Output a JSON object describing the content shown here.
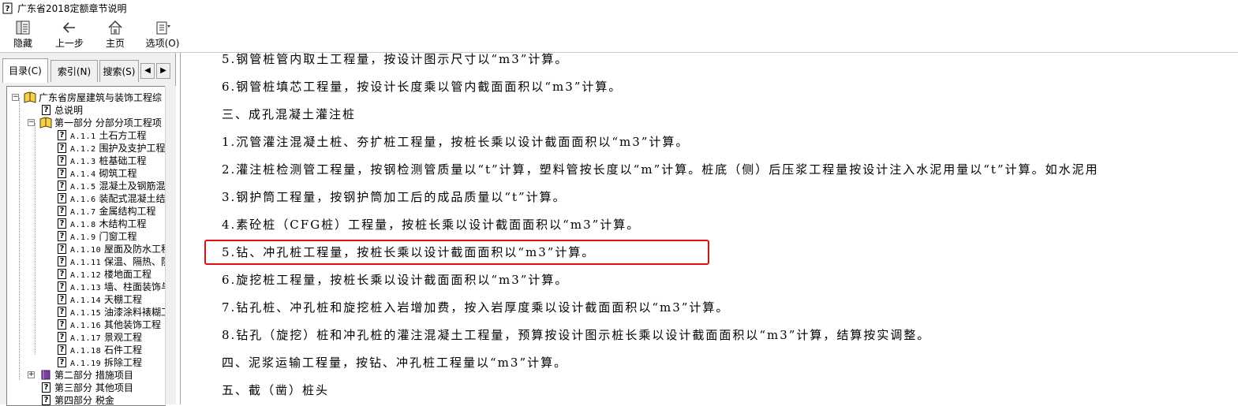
{
  "window": {
    "title": "广东省2018定额章节说明"
  },
  "toolbar": {
    "buttons": [
      {
        "label": "隐藏",
        "icon": "hide-icon"
      },
      {
        "label": "上一步",
        "icon": "back-arrow-icon"
      },
      {
        "label": "主页",
        "icon": "home-icon"
      },
      {
        "label": "选项(O)",
        "icon": "options-icon"
      }
    ]
  },
  "tabs": [
    {
      "label": "目录(C)",
      "active": true
    },
    {
      "label": "索引(N)"
    },
    {
      "label": "搜索(S)"
    }
  ],
  "tree": {
    "root": "广东省房屋建筑与装饰工程综",
    "general": "总说明",
    "part1": "第一部分 分部分项工程项",
    "chapters": [
      {
        "code": "A.1.1",
        "name": "土石方工程"
      },
      {
        "code": "A.1.2",
        "name": "围护及支护工程"
      },
      {
        "code": "A.1.3",
        "name": "桩基础工程"
      },
      {
        "code": "A.1.4",
        "name": "砌筑工程"
      },
      {
        "code": "A.1.5",
        "name": "混凝土及钢筋混"
      },
      {
        "code": "A.1.6",
        "name": "装配式混凝土结"
      },
      {
        "code": "A.1.7",
        "name": "金属结构工程"
      },
      {
        "code": "A.1.8",
        "name": "木结构工程"
      },
      {
        "code": "A.1.9",
        "name": "门窗工程"
      },
      {
        "code": "A.1.10",
        "name": "屋面及防水工程"
      },
      {
        "code": "A.1.11",
        "name": "保温、隔热、防"
      },
      {
        "code": "A.1.12",
        "name": "楼地面工程"
      },
      {
        "code": "A.1.13",
        "name": "墙、柱面装饰与"
      },
      {
        "code": "A.1.14",
        "name": "天棚工程"
      },
      {
        "code": "A.1.15",
        "name": "油漆涂料裱糊工"
      },
      {
        "code": "A.1.16",
        "name": "其他装饰工程"
      },
      {
        "code": "A.1.17",
        "name": "景观工程"
      },
      {
        "code": "A.1.18",
        "name": "石件工程"
      },
      {
        "code": "A.1.19",
        "name": "拆除工程"
      }
    ],
    "part2": "第二部分 措施项目",
    "part3": "第三部分 其他项目",
    "part4": "第四部分 税金"
  },
  "content": {
    "lines": [
      "5.钢管桩管内取土工程量，按设计图示尺寸以“m3”计算。",
      "6.钢管桩填芯工程量，按设计长度乘以管内截面面积以“m3”计算。",
      "三、成孔混凝土灌注桩",
      "1.沉管灌注混凝土桩、夯扩桩工程量，按桩长乘以设计截面面积以“m3”计算。",
      "2.灌注桩检测管工程量，按钢检测管质量以“t”计算，塑料管按长度以“m”计算。桩底（侧）后压浆工程量按设计注入水泥用量以“t”计算。如水泥用",
      "3.钢护筒工程量，按钢护筒加工后的成品质量以“t”计算。",
      "4.素砼桩（CFG桩）工程量，按桩长乘以设计截面面积以“m3”计算。",
      "5.钻、冲孔桩工程量，按桩长乘以设计截面面积以“m3”计算。",
      "6.旋挖桩工程量，按桩长乘以设计截面面积以“m3”计算。",
      "7.钻孔桩、冲孔桩和旋挖桩入岩增加费，按入岩厚度乘以设计截面面积以“m3”计算。",
      "8.钻孔（旋挖）桩和冲孔桩的灌注混凝土工程量，预算按设计图示桩长乘以设计截面面积以“m3”计算，结算按实调整。",
      "四、泥浆运输工程量，按钻、冲孔桩工程量以“m3”计算。",
      "五、截（凿）桩头"
    ],
    "highlight_color": "#e01010"
  }
}
